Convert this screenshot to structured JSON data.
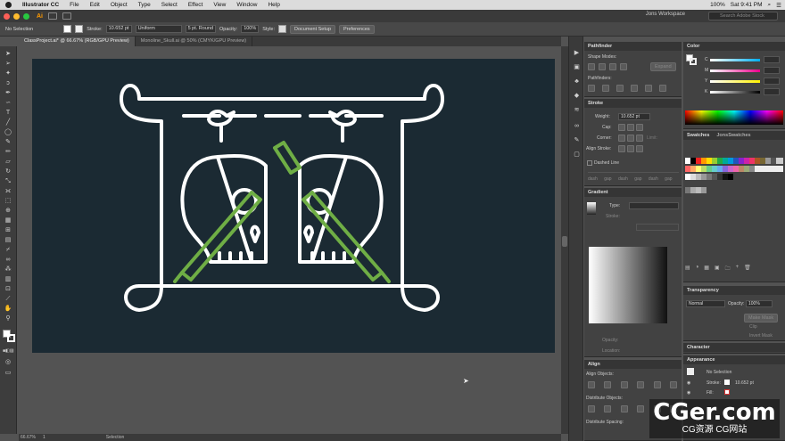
{
  "menubar": {
    "app": "Illustrator CC",
    "items": [
      "File",
      "Edit",
      "Object",
      "Type",
      "Select",
      "Effect",
      "View",
      "Window",
      "Help"
    ],
    "battery": "100%",
    "clock": "Sat 9:41 PM"
  },
  "appbar": {
    "logo": "Ai",
    "workspace": "Jons Workspace",
    "search_placeholder": "Search Adobe Stock"
  },
  "control": {
    "selection": "No Selection",
    "stroke_label": "Stroke:",
    "stroke_weight": "10.652 pt",
    "profile": "Uniform",
    "brush": "5 pt. Round",
    "opacity_label": "Opacity:",
    "opacity": "100%",
    "style_label": "Style:",
    "doc_setup": "Document Setup",
    "preferences": "Preferences"
  },
  "tabs": [
    "ClassProject.ai* @ 66.67% (RGB/GPU Preview)",
    "Monoline_Skull.ai @ 50% (CMYK/GPU Preview)"
  ],
  "status": {
    "zoom": "66.67%",
    "artboard": "1",
    "tool": "Selection"
  },
  "pathfinder": {
    "title": "Pathfinder",
    "shape_modes": "Shape Modes:",
    "expand": "Expand",
    "pathfinders": "Pathfinders:"
  },
  "stroke": {
    "title": "Stroke",
    "weight_label": "Weight:",
    "weight": "10.652 pt",
    "cap_label": "Cap:",
    "corner_label": "Corner:",
    "limit_label": "Limit:",
    "align_label": "Align Stroke:",
    "dashed_label": "Dashed Line",
    "dash_gap": "dash gap dash gap dash gap"
  },
  "gradient": {
    "title": "Gradient",
    "type_label": "Type:",
    "stroke_label": "Stroke:",
    "opacity_label": "Opacity:",
    "location_label": "Location:"
  },
  "align": {
    "title": "Align",
    "objects_label": "Align Objects:",
    "distribute_label": "Distribute Objects:",
    "spacing_label": "Distribute Spacing:"
  },
  "color": {
    "title": "Color",
    "channels": [
      "C",
      "M",
      "Y",
      "K"
    ]
  },
  "swatches": {
    "tabs": [
      "Swatches",
      "JonsSwatches"
    ]
  },
  "transparency": {
    "title": "Transparency",
    "mode": "Normal",
    "opacity_label": "Opacity:",
    "opacity": "100%",
    "make_mask": "Make Mask",
    "clip": "Clip",
    "invert": "Invert Mask"
  },
  "character": {
    "title": "Character"
  },
  "appearance": {
    "title": "Appearance",
    "selection": "No Selection",
    "stroke_label": "Stroke:",
    "stroke_value": "10.652 pt",
    "fill_label": "Fill:"
  },
  "artwork": {
    "background": "#1b2a33",
    "line_color": "#ffffff",
    "accent_color": "#6fae45"
  },
  "watermark": {
    "main": "CGer.com",
    "sub": "CG资源 CG网站"
  }
}
